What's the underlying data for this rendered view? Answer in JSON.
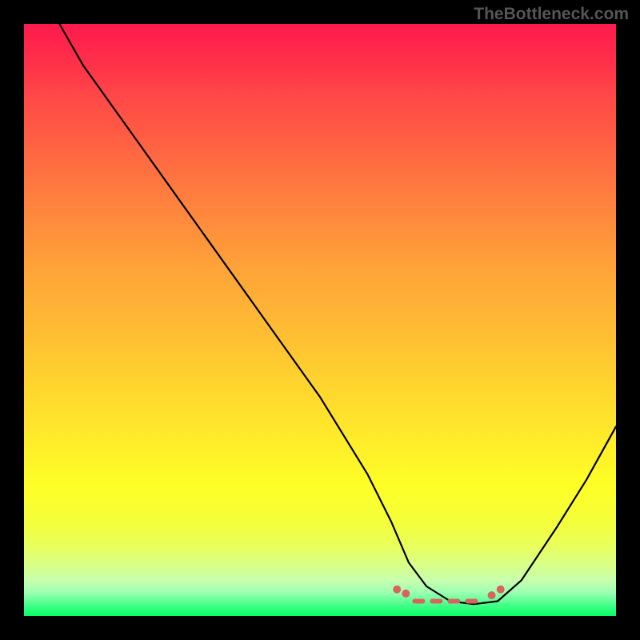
{
  "watermark": "TheBottleneck.com",
  "chart_data": {
    "type": "line",
    "title": "",
    "xlabel": "",
    "ylabel": "",
    "xlim": [
      0,
      100
    ],
    "ylim": [
      0,
      100
    ],
    "grid": false,
    "legend": false,
    "series": [
      {
        "name": "curve",
        "x": [
          6,
          10,
          15,
          20,
          30,
          40,
          50,
          58,
          62,
          65,
          68,
          72,
          76,
          80,
          84,
          90,
          95,
          100
        ],
        "values": [
          100,
          93,
          86,
          79,
          65,
          51,
          37,
          24,
          16,
          9,
          5,
          2.5,
          2,
          2.5,
          6,
          15,
          23,
          32
        ]
      },
      {
        "name": "marker-dots",
        "x": [
          63,
          64.5,
          79,
          80.5
        ],
        "values": [
          4.5,
          3.8,
          3.5,
          4.5
        ]
      },
      {
        "name": "marker-dashes",
        "x_start": 66,
        "x_end": 77,
        "y": 2.5
      }
    ],
    "background_gradient": {
      "top": "#ff1a4d",
      "bottom": "#00ff66"
    }
  }
}
